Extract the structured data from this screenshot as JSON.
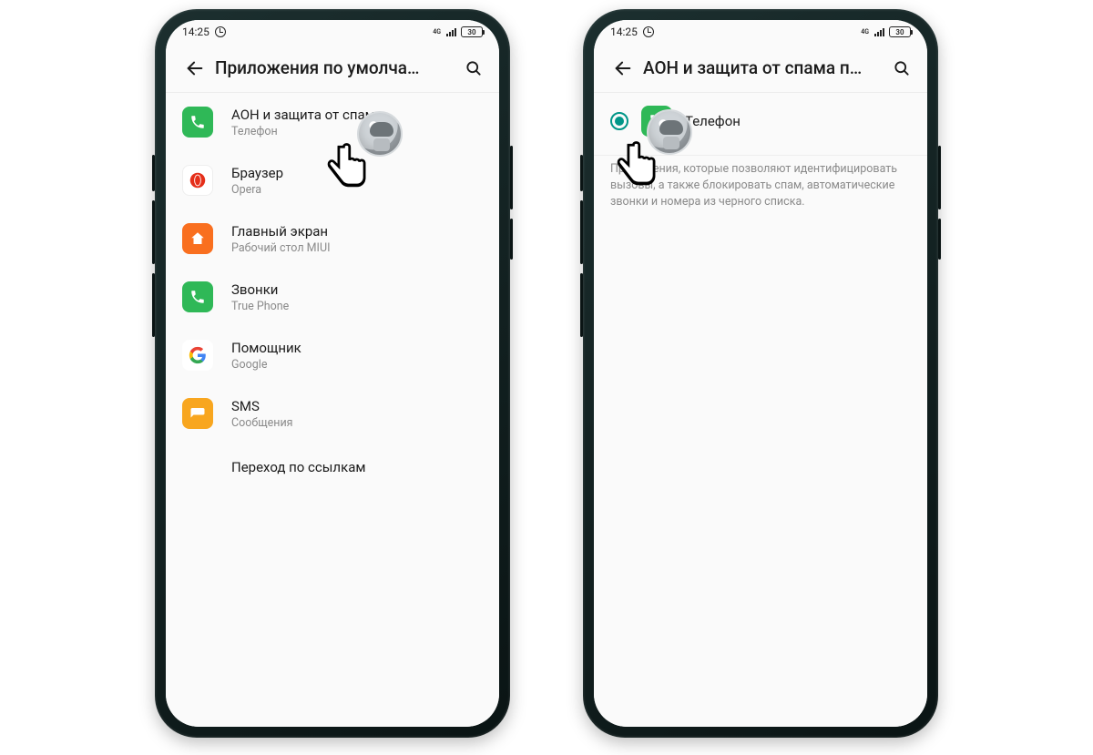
{
  "status": {
    "time": "14:25",
    "network": "4G",
    "battery": "30"
  },
  "screenA": {
    "title": "Приложения по умолча…",
    "items": [
      {
        "title": "АОН и защита от спама",
        "sub": "Телефон"
      },
      {
        "title": "Браузер",
        "sub": "Opera"
      },
      {
        "title": "Главный экран",
        "sub": "Рабочий стол MIUI"
      },
      {
        "title": "Звонки",
        "sub": "True Phone"
      },
      {
        "title": "Помощник",
        "sub": "Google"
      },
      {
        "title": "SMS",
        "sub": "Сообщения"
      }
    ],
    "link": "Переход по ссылкам"
  },
  "screenB": {
    "title": "АОН и защита от спама п…",
    "option": "Телефон",
    "description": "Приложения, которые позволяют идентифицировать вызовы, а также блокировать спам, автоматические звонки и номера из черного списка."
  }
}
